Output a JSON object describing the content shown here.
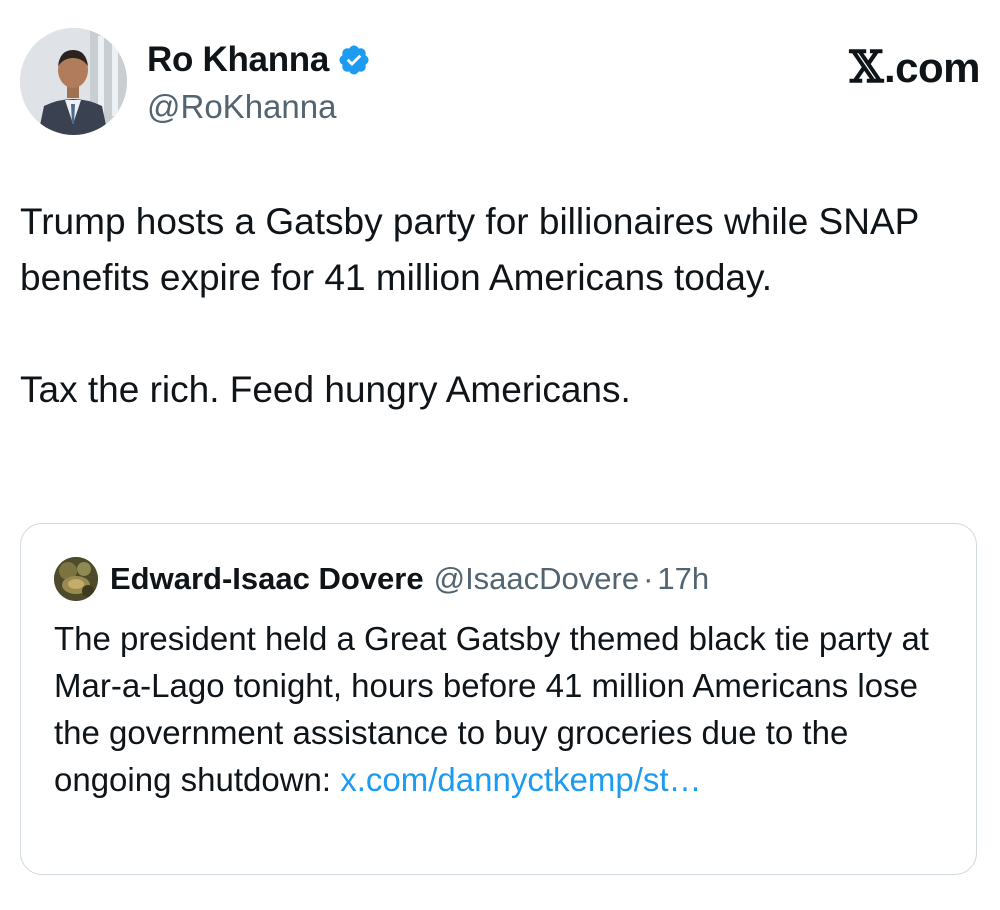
{
  "author": {
    "display_name": "Ro Khanna",
    "handle": "@RoKhanna",
    "verified": true,
    "verified_color": "#1d9bf0"
  },
  "site": {
    "mark_glyph": "𝕏",
    "mark_text": ".com"
  },
  "tweet": {
    "paragraph_1": "Trump hosts a Gatsby party for billionaires while SNAP benefits expire for 41 million Americans today.",
    "paragraph_2": "Tax the rich. Feed hungry Americans."
  },
  "quoted_tweet": {
    "display_name": "Edward-Isaac Dovere",
    "handle": "@IsaacDovere",
    "separator": "·",
    "time": "17h",
    "text": "The president held a Great Gatsby themed black tie party at Mar-a-Lago tonight, hours before 41 million Americans lose the government assistance to buy groceries due to the ongoing shutdown: ",
    "link_text": "x.com/dannyctkemp/st…",
    "link_color": "#1d9bf0"
  },
  "colors": {
    "text_primary": "#0f1419",
    "text_secondary": "#536471",
    "border": "#cfd9de"
  }
}
